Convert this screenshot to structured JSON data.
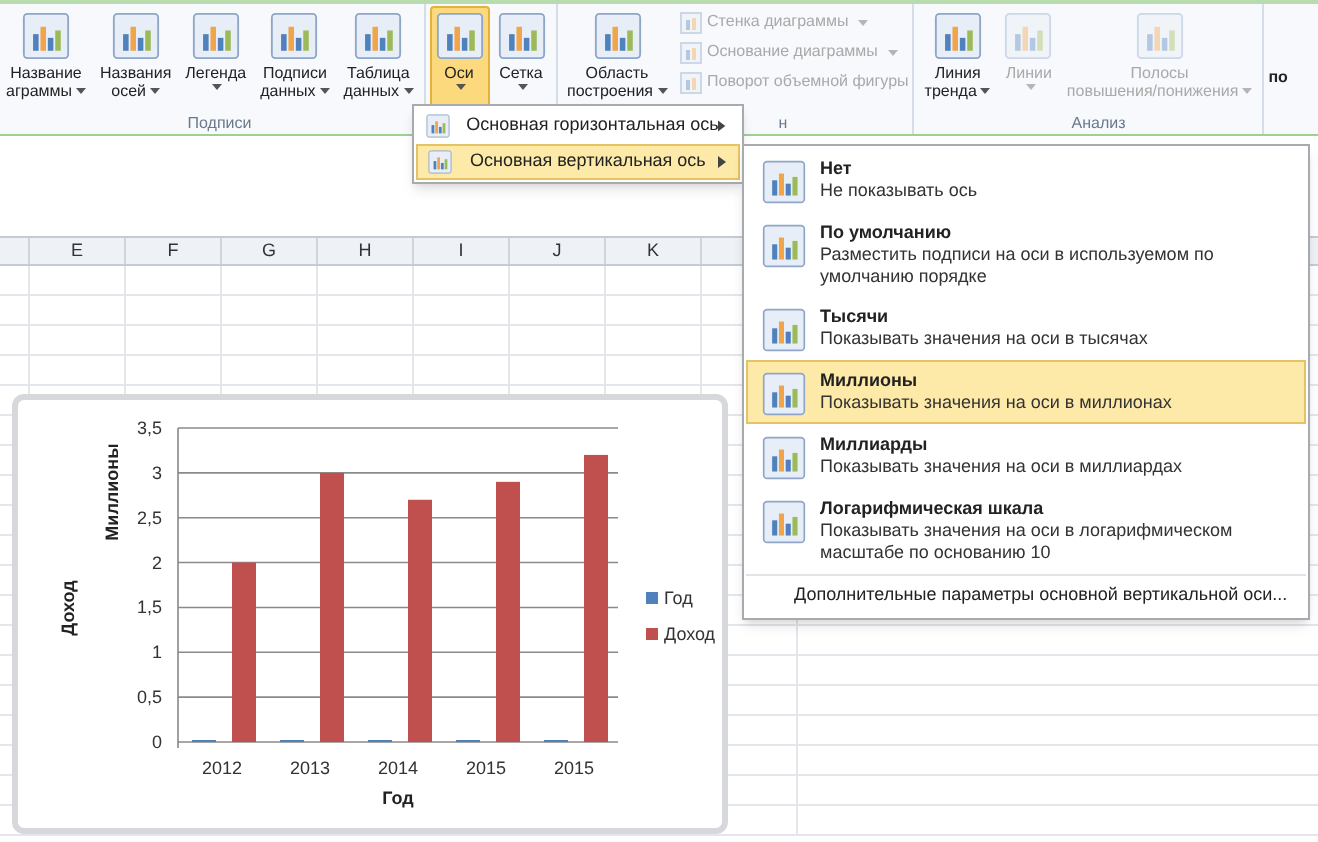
{
  "ribbon": {
    "groups": [
      {
        "label": "Подписи",
        "buttons": [
          {
            "lines": [
              "Название",
              "аграммы"
            ],
            "dropdown": true,
            "pressed": false,
            "disabled": false
          },
          {
            "lines": [
              "Названия",
              "осей"
            ],
            "dropdown": true,
            "pressed": false,
            "disabled": false
          },
          {
            "lines": [
              "Легенда"
            ],
            "dropdown": true,
            "pressed": false,
            "disabled": false
          },
          {
            "lines": [
              "Подписи",
              "данных"
            ],
            "dropdown": true,
            "pressed": false,
            "disabled": false
          },
          {
            "lines": [
              "Таблица",
              "данных"
            ],
            "dropdown": true,
            "pressed": false,
            "disabled": false
          }
        ]
      },
      {
        "buttons": [
          {
            "lines": [
              "Оси"
            ],
            "dropdown": true,
            "pressed": true,
            "disabled": false
          },
          {
            "lines": [
              "Сетка"
            ],
            "dropdown": true,
            "pressed": false,
            "disabled": false
          }
        ]
      },
      {
        "label": "н",
        "buttons": [
          {
            "lines": [
              "Область",
              "построения"
            ],
            "dropdown": true,
            "pressed": false,
            "disabled": false
          }
        ],
        "small": [
          {
            "label": "Стенка диаграммы",
            "dropdown": true,
            "disabled": true
          },
          {
            "label": "Основание диаграммы",
            "dropdown": true,
            "disabled": true
          },
          {
            "label": "Поворот объемной фигуры",
            "dropdown": false,
            "disabled": true
          }
        ]
      },
      {
        "label": "Анализ",
        "buttons": [
          {
            "lines": [
              "Линия",
              "тренда"
            ],
            "dropdown": true,
            "pressed": false,
            "disabled": false
          },
          {
            "lines": [
              "Линии"
            ],
            "dropdown": true,
            "pressed": false,
            "disabled": true
          },
          {
            "lines": [
              "Полосы",
              "повышения/понижения"
            ],
            "dropdown": true,
            "pressed": false,
            "disabled": true
          }
        ]
      }
    ],
    "cut_label": "по"
  },
  "axes_menu": {
    "items": [
      {
        "label": "Основная горизонтальная ось",
        "selected": false
      },
      {
        "label": "Основная вертикальная ось",
        "selected": true
      }
    ]
  },
  "vertical_axis_menu": {
    "items": [
      {
        "title": "Нет",
        "description": "Не показывать ось",
        "selected": false
      },
      {
        "title": "По умолчанию",
        "description": "Разместить подписи на оси в используемом по умолчанию порядке",
        "selected": false
      },
      {
        "title": "Тысячи",
        "description": "Показывать значения на оси в тысячах",
        "selected": false
      },
      {
        "title": "Миллионы",
        "description": "Показывать значения на оси в миллионах",
        "selected": true
      },
      {
        "title": "Миллиарды",
        "description": "Показывать значения на оси в миллиардах",
        "selected": false
      },
      {
        "title": "Логарифмическая шкала",
        "description": "Показывать значения на оси в логарифмическом масштабе по основанию 10",
        "selected": false
      }
    ],
    "footer": "Дополнительные параметры основной вертикальной оси..."
  },
  "sheet": {
    "columns": [
      "E",
      "F",
      "G",
      "H",
      "I",
      "J",
      "K"
    ]
  },
  "chart": {
    "chart_data": {
      "type": "bar",
      "xlabel": "Год",
      "ylabel": "Доход",
      "categories": [
        "2012",
        "2013",
        "2014",
        "2015",
        "2015"
      ],
      "series": [
        {
          "name": "Год",
          "color": "#4f81bd",
          "values": [
            0,
            0,
            0,
            0,
            0
          ]
        },
        {
          "name": "Доход",
          "color": "#c0504d",
          "values": [
            2,
            3,
            2.7,
            2.9,
            3.2
          ]
        }
      ],
      "grid": true,
      "legend": true,
      "ylim": [
        0,
        3.5
      ],
      "yticks": [
        {
          "value": 0,
          "label": "0"
        },
        {
          "value": 0.5,
          "label": "0,5"
        },
        {
          "value": 1,
          "label": "1"
        },
        {
          "value": 1.5,
          "label": "1,5"
        },
        {
          "value": 2,
          "label": "2"
        },
        {
          "value": 2.5,
          "label": "2,5"
        },
        {
          "value": 3,
          "label": "3"
        },
        {
          "value": 3.5,
          "label": "3,5"
        }
      ]
    },
    "unit_label": "Миллионы"
  }
}
